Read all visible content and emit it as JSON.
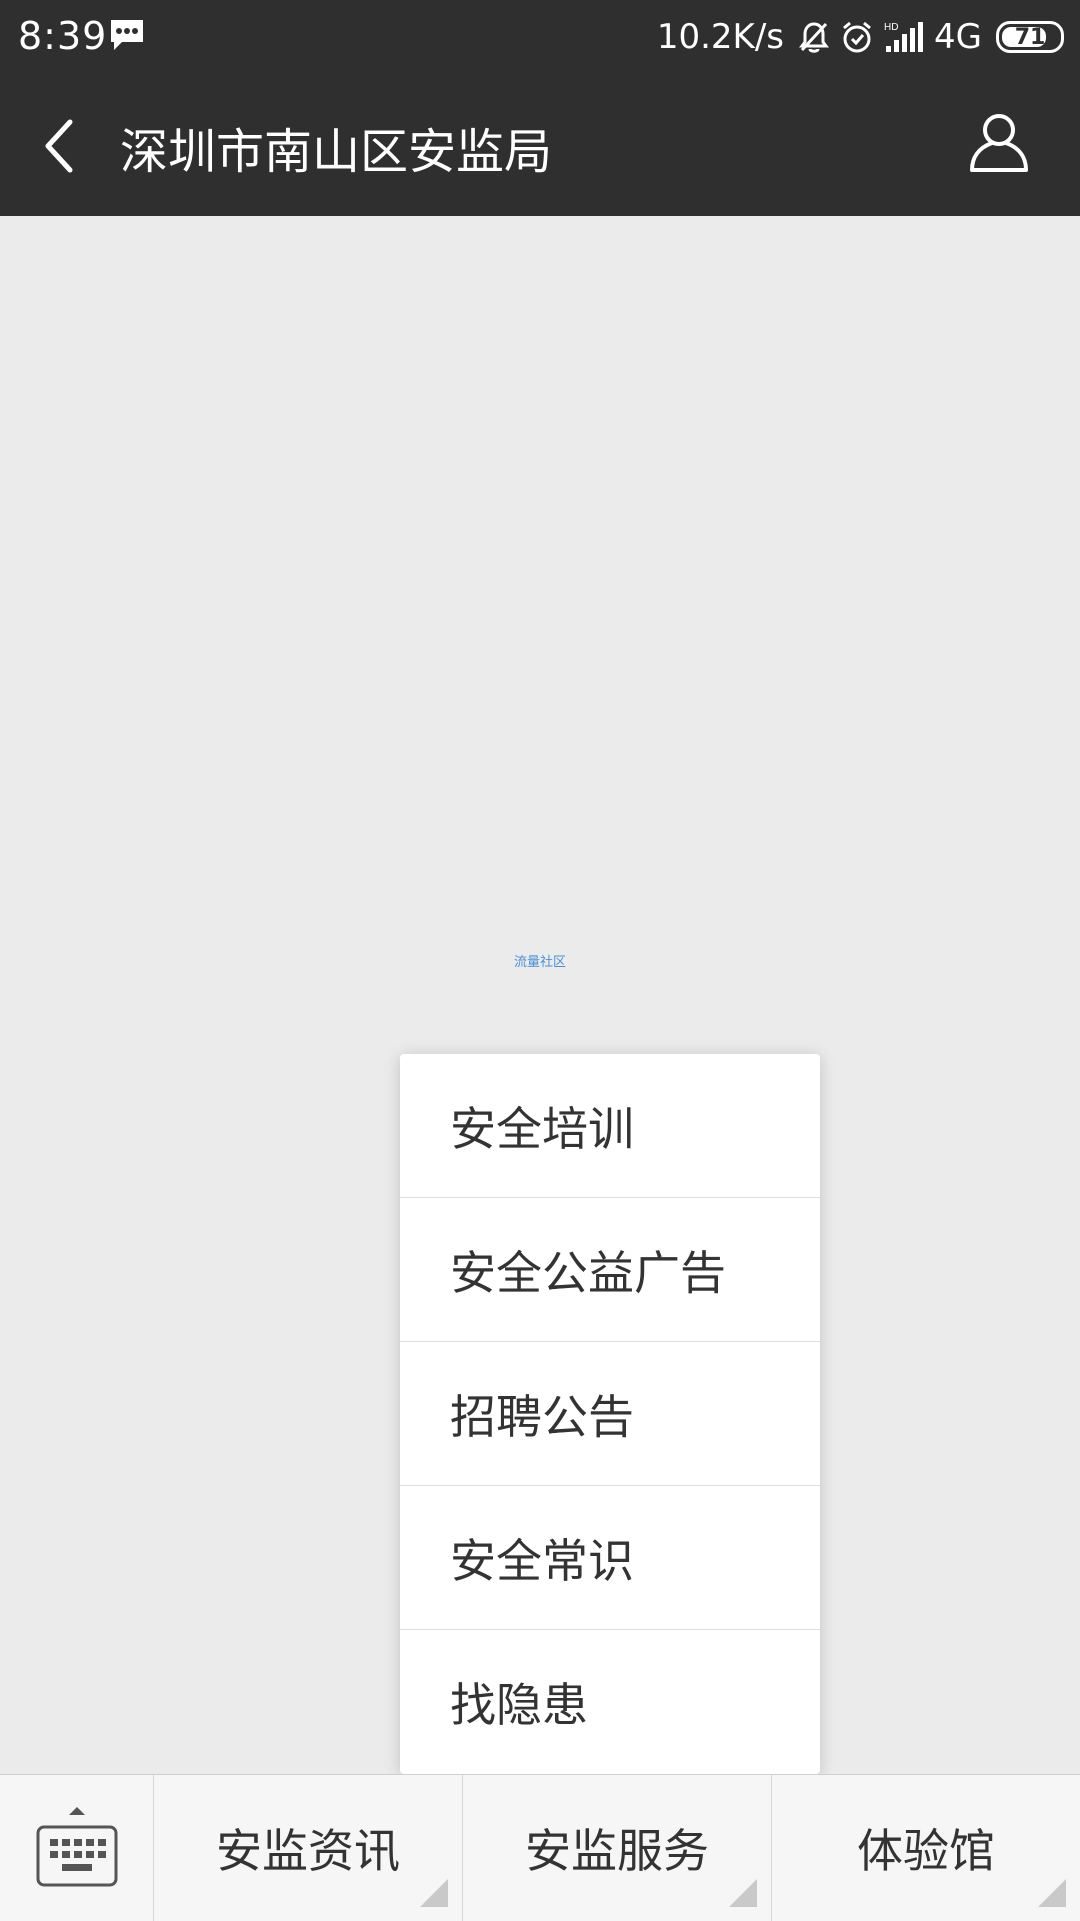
{
  "status_bar": {
    "time": "8:39",
    "network_speed": "10.2K/s",
    "network_type": "4G",
    "battery_level": "71",
    "icons": [
      "message-icon",
      "bell-off-icon",
      "alarm-icon",
      "signal-icon"
    ]
  },
  "nav": {
    "title": "深圳市南山区安监局",
    "icons": [
      "back-icon",
      "profile-icon"
    ]
  },
  "content": {
    "watermark": "流量社区"
  },
  "popup_menu": {
    "items": [
      {
        "label": "安全培训"
      },
      {
        "label": "安全公益广告"
      },
      {
        "label": "招聘公告"
      },
      {
        "label": "安全常识"
      },
      {
        "label": "找隐患"
      }
    ]
  },
  "bottom_bar": {
    "tabs": [
      {
        "label": "安监资讯"
      },
      {
        "label": "安监服务"
      },
      {
        "label": "体验馆"
      }
    ]
  },
  "colors": {
    "header_bg": "#2f2f2f",
    "content_bg": "#ebebeb",
    "menu_text": "#333333"
  }
}
